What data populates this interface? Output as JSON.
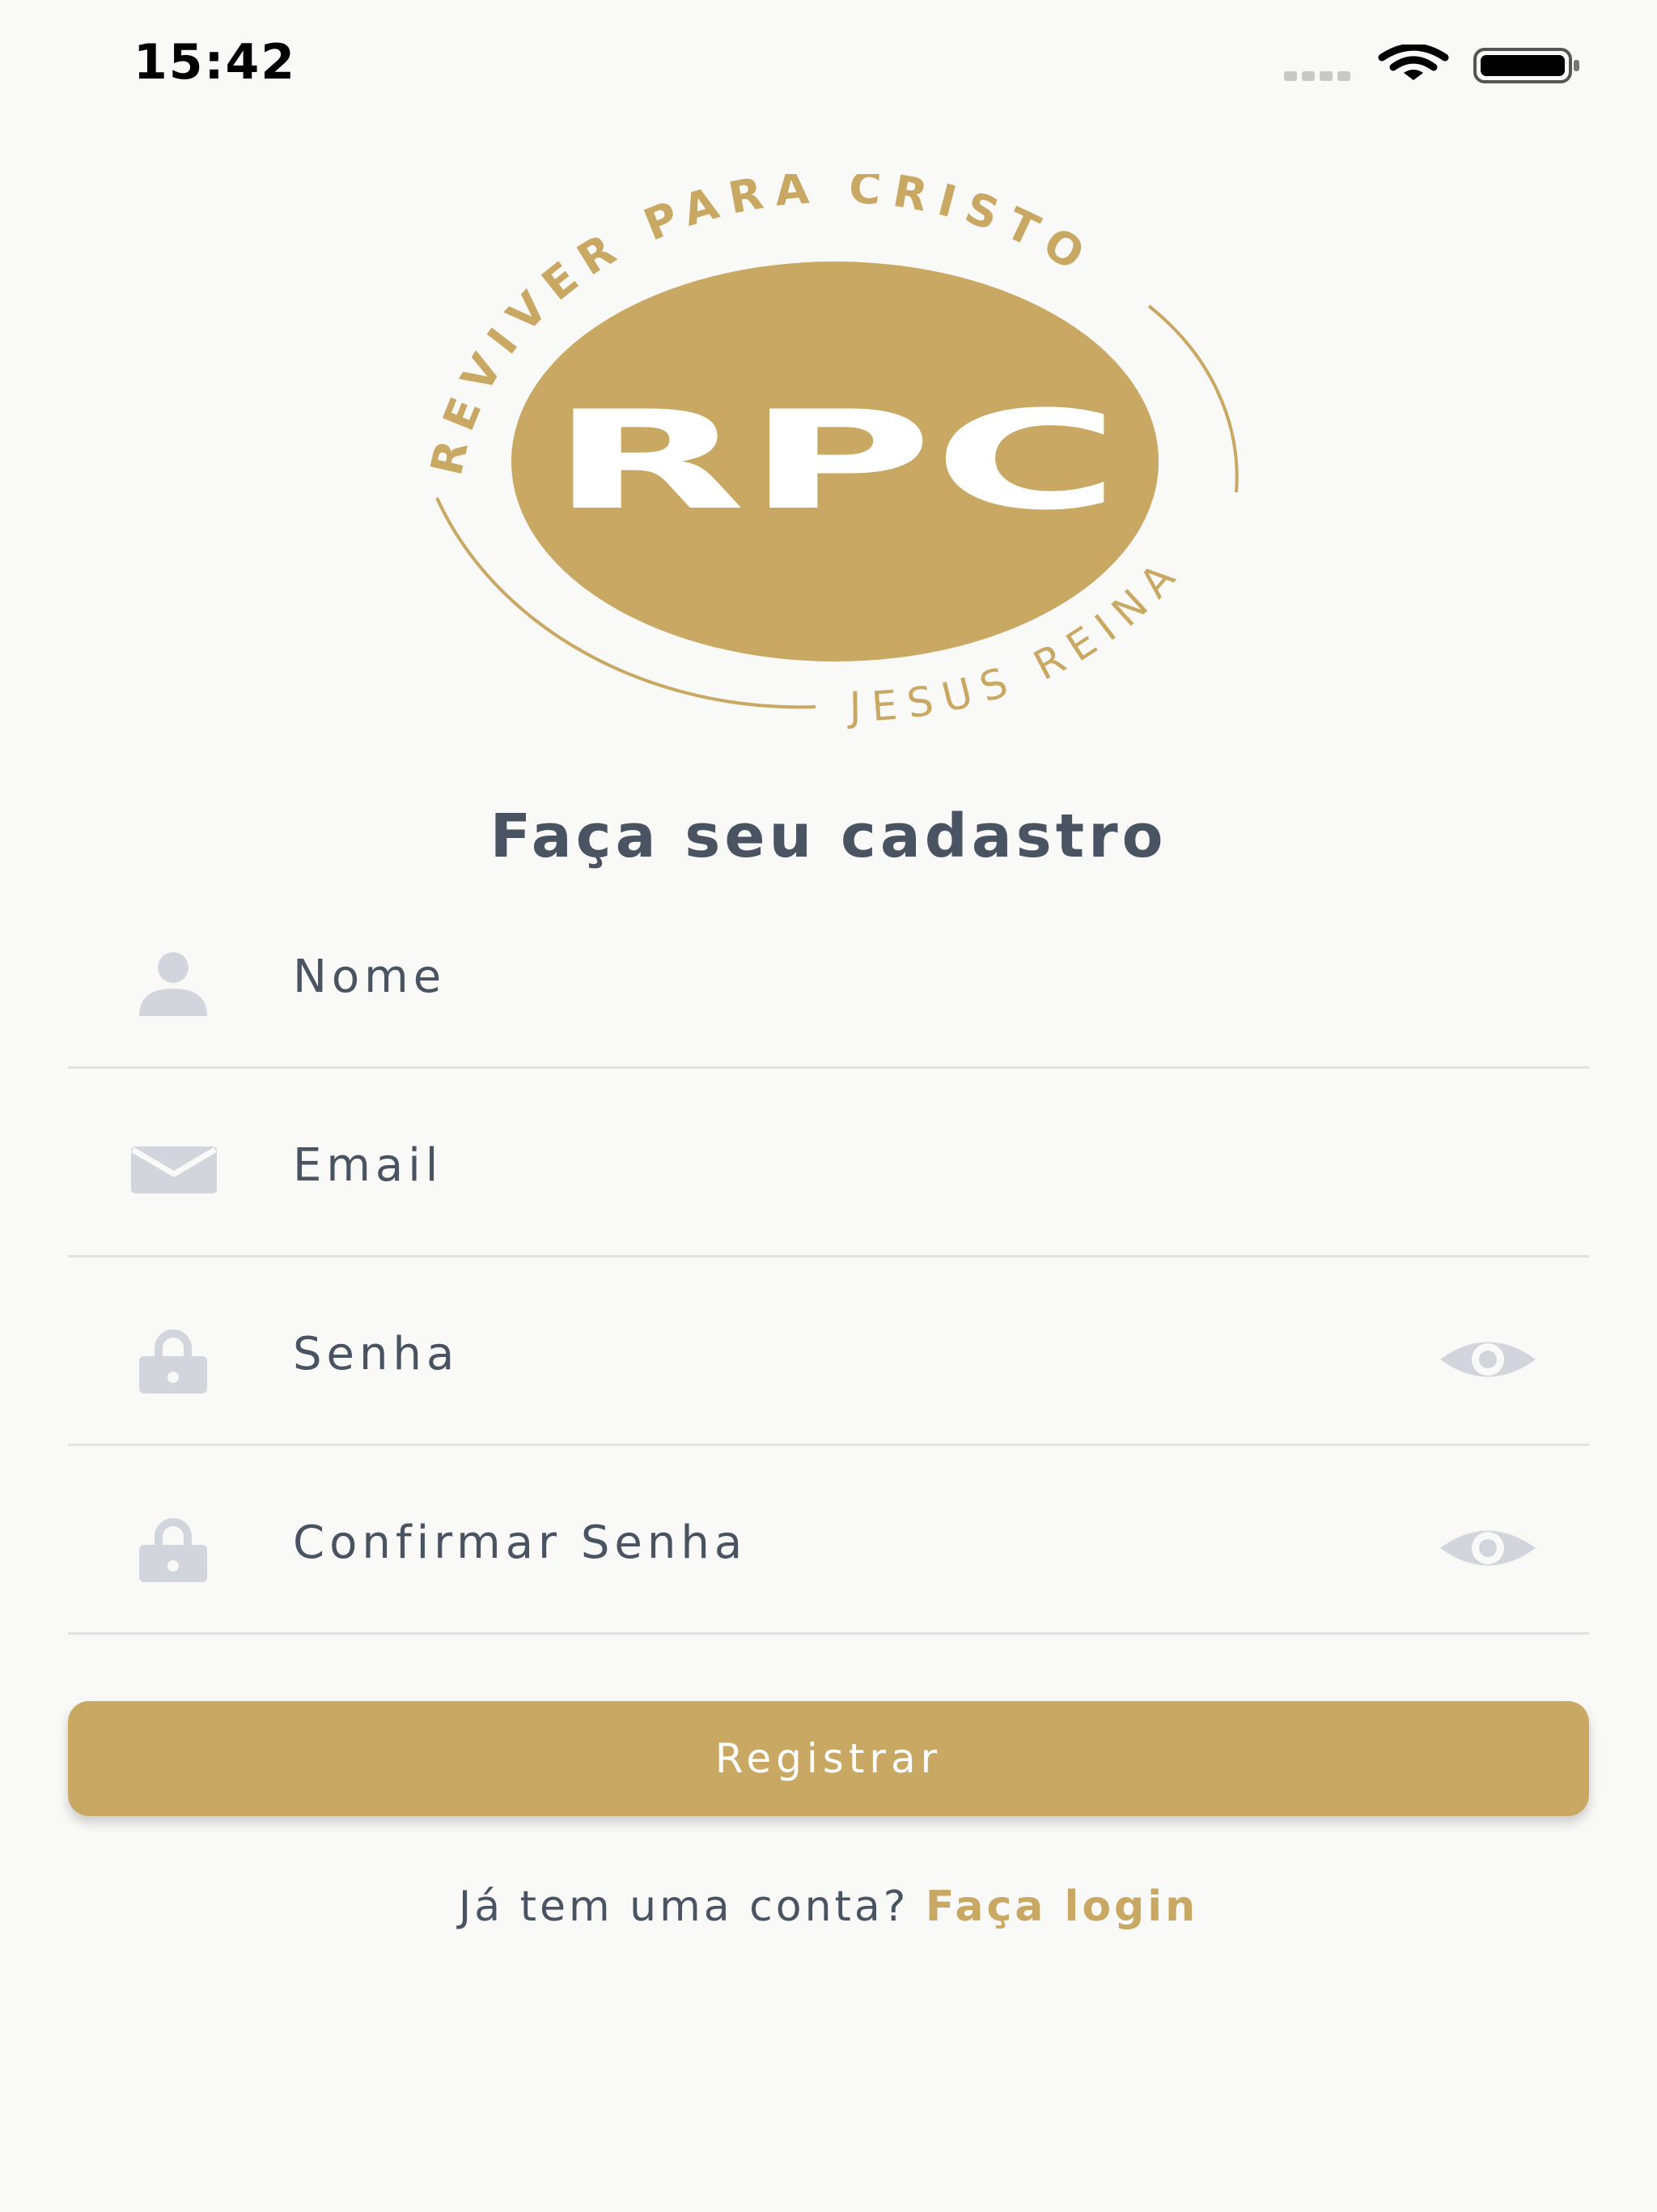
{
  "status_bar": {
    "time": "15:42",
    "icons": [
      "signal-icon",
      "wifi-icon",
      "battery-icon"
    ]
  },
  "logo": {
    "monogram": "RPC",
    "top_text": "REVIVER PARA CRISTO",
    "bottom_text": "JESUS REINA",
    "color": "#c8a862"
  },
  "title": "Faça seu cadastro",
  "form": {
    "fields": [
      {
        "placeholder": "Nome",
        "icon": "user-icon",
        "value": ""
      },
      {
        "placeholder": "Email",
        "icon": "mail-icon",
        "value": ""
      },
      {
        "placeholder": "Senha",
        "icon": "lock-icon",
        "value": "",
        "toggle_icon": "eye-icon"
      },
      {
        "placeholder": "Confirmar Senha",
        "icon": "lock-icon",
        "value": "",
        "toggle_icon": "eye-icon"
      }
    ],
    "submit_label": "Registrar"
  },
  "footer": {
    "prompt": "Já tem uma conta?",
    "link_label": "Faça login"
  },
  "colors": {
    "accent": "#c8a862",
    "text": "#4a5361",
    "icon": "#d2d5db",
    "background": "#f9f9f7",
    "divider": "#e1e2e4"
  }
}
